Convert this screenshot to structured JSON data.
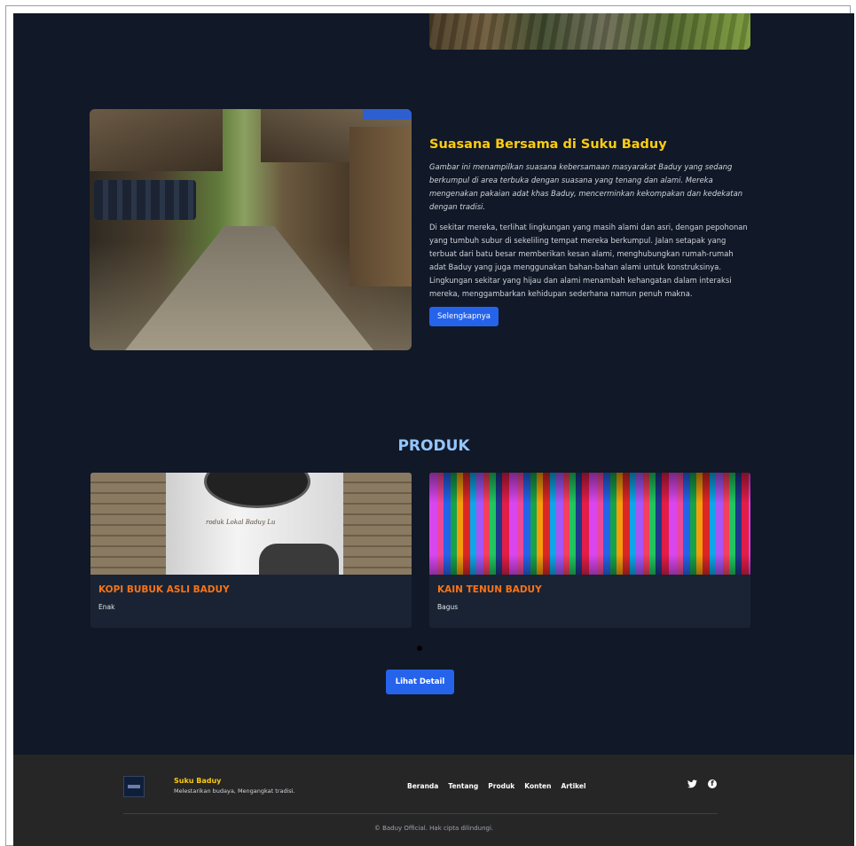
{
  "feature": {
    "title": "Suasana Bersama di Suku Baduy",
    "description": "Gambar ini menampilkan suasana kebersamaan masyarakat Baduy yang sedang berkumpul di area terbuka dengan suasana yang tenang dan alami. Mereka mengenakan pakaian adat khas Baduy, mencerminkan kekompakan dan kedekatan dengan tradisi.",
    "body": "Di sekitar mereka, terlihat lingkungan yang masih alami dan asri, dengan pepohonan yang tumbuh subur di sekeliling tempat mereka berkumpul. Jalan setapak yang terbuat dari batu besar memberikan kesan alami, menghubungkan rumah-rumah adat Baduy yang juga menggunakan bahan-bahan alami untuk konstruksinya. Lingkungan sekitar yang hijau dan alami menambah kehangatan dalam interaksi mereka, menggambarkan kehidupan sederhana namun penuh makna.",
    "button_label": "Selengkapnya"
  },
  "products": {
    "title": "PRODUK",
    "items": [
      {
        "name": "KOPI BUBUK ASLI BADUY",
        "description": "Enak",
        "image_text": "roduk Lokal Baduy Lu"
      },
      {
        "name": "KAIN TENUN BADUY",
        "description": "Bagus"
      }
    ],
    "button_label": "Lihat Detail"
  },
  "footer": {
    "brand": "Suku Baduy",
    "tagline": "Melestarikan budaya, Mengangkat tradisi.",
    "nav": [
      "Beranda",
      "Tentang",
      "Produk",
      "Konten",
      "Artikel"
    ],
    "social_icons": [
      "twitter-icon",
      "facebook-icon"
    ],
    "copyright": "© Baduy Official. Hak cipta dilindungi."
  },
  "colors": {
    "background": "#111827",
    "accent_yellow": "#facc15",
    "accent_orange": "#f97316",
    "primary_button": "#2563eb",
    "section_title": "#93c5fd",
    "footer_bg": "#262626"
  }
}
